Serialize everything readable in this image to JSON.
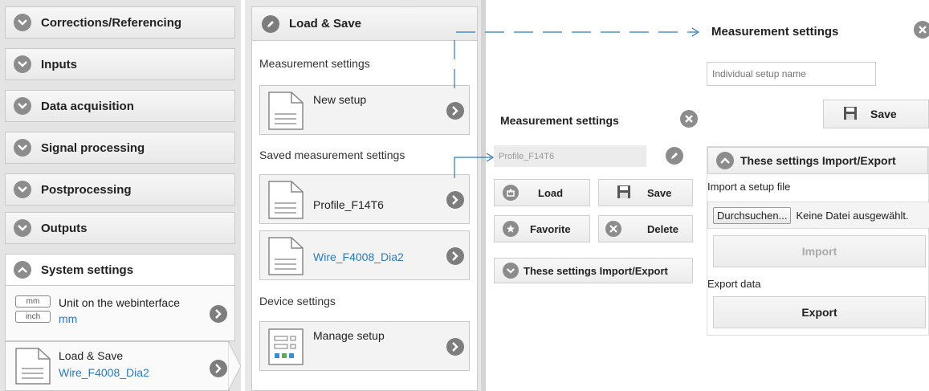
{
  "left_menu": {
    "items": [
      {
        "label": "Corrections/Referencing"
      },
      {
        "label": "Inputs"
      },
      {
        "label": "Data acquisition"
      },
      {
        "label": "Signal processing"
      },
      {
        "label": "Postprocessing"
      },
      {
        "label": "Outputs"
      },
      {
        "label": "System settings"
      }
    ],
    "unit_entry": {
      "title": "Unit on the webinterface",
      "value": "mm",
      "icon_top": "mm",
      "icon_bottom": "inch"
    },
    "load_save_entry": {
      "title": "Load & Save",
      "value": "Wire_F4008_Dia2"
    }
  },
  "middle_panel": {
    "header": "Load & Save",
    "sections": {
      "measurement": "Measurement settings",
      "saved": "Saved measurement settings",
      "device": "Device settings"
    },
    "new_setup": "New setup",
    "saved_items": [
      {
        "name": "Profile_F14T6"
      },
      {
        "name": "Wire_F4008_Dia2"
      }
    ],
    "manage_setup": "Manage setup"
  },
  "dialog_small": {
    "title": "Measurement settings",
    "name_value": "Profile_F14T6",
    "load": "Load",
    "save": "Save",
    "favorite": "Favorite",
    "delete": "Delete",
    "import_export": "These settings Import/Export"
  },
  "dialog_large": {
    "title": "Measurement settings",
    "name_placeholder": "Individual setup name",
    "save": "Save",
    "import_export": "These settings Import/Export",
    "import_label": "Import a setup file",
    "browse": "Durchsuchen...",
    "no_file": "Keine Datei ausgewählt.",
    "import": "Import",
    "export_label": "Export data",
    "export": "Export"
  },
  "colors": {
    "accent_blue": "#2a7ac0",
    "icon_grey": "#8c8c8c"
  }
}
